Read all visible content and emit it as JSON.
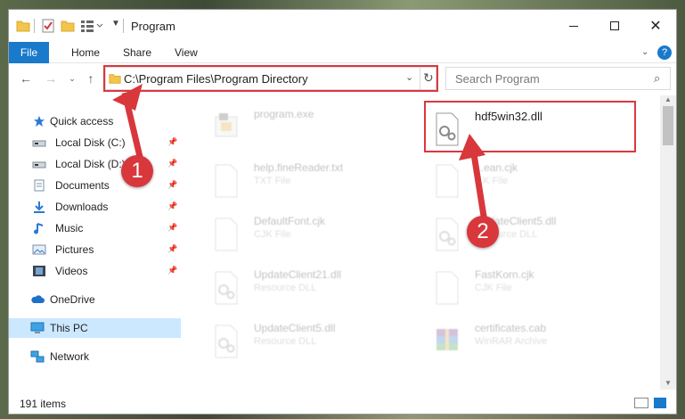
{
  "window": {
    "title": "Program"
  },
  "ribbon": {
    "tabs": [
      "File",
      "Home",
      "Share",
      "View"
    ]
  },
  "nav": {
    "address": "C:\\Program Files\\Program Directory",
    "search_placeholder": "Search Program"
  },
  "sidebar": {
    "items": [
      {
        "label": "Quick access",
        "icon": "star-icon",
        "pinned": false
      },
      {
        "label": "Local Disk (C:)",
        "icon": "drive-icon",
        "pinned": true
      },
      {
        "label": "Local Disk (D:)",
        "icon": "drive-icon",
        "pinned": true
      },
      {
        "label": "Documents",
        "icon": "documents-icon",
        "pinned": true
      },
      {
        "label": "Downloads",
        "icon": "download-icon",
        "pinned": true
      },
      {
        "label": "Music",
        "icon": "music-icon",
        "pinned": true
      },
      {
        "label": "Pictures",
        "icon": "pictures-icon",
        "pinned": true
      },
      {
        "label": "Videos",
        "icon": "videos-icon",
        "pinned": true
      },
      {
        "label": "OneDrive",
        "icon": "cloud-icon",
        "pinned": false
      },
      {
        "label": "This PC",
        "icon": "computer-icon",
        "pinned": false
      },
      {
        "label": "Network",
        "icon": "network-icon",
        "pinned": false
      }
    ]
  },
  "files": [
    {
      "name": "program.exe",
      "type": ""
    },
    {
      "name": "hdf5win32.dll",
      "type": ""
    },
    {
      "name": "help.fineReader.txt",
      "type": "TXT File"
    },
    {
      "name": "...ean.cjk",
      "type": "...K File"
    },
    {
      "name": "DefaultFont.cjk",
      "type": "CJK File"
    },
    {
      "name": "UpdateClient5.dll",
      "type": "Resource DLL"
    },
    {
      "name": "UpdateClient21.dll",
      "type": "Resource DLL"
    },
    {
      "name": "FastKorn.cjk",
      "type": "CJK File"
    },
    {
      "name": "UpdateClient5.dll",
      "type": "Resource DLL"
    },
    {
      "name": "certificates.cab",
      "type": "WinRAR Archive"
    }
  ],
  "status": {
    "items": "191 items"
  },
  "callouts": [
    "1",
    "2"
  ],
  "colors": {
    "accent": "#1979ca",
    "highlight": "#d9383f",
    "selected": "#cce8ff"
  }
}
